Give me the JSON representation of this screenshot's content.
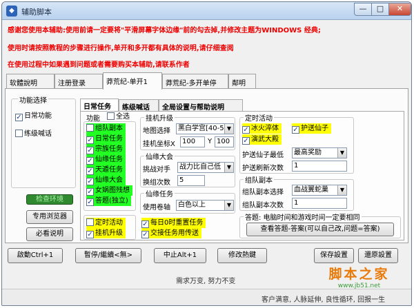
{
  "window": {
    "title": "辅助脚本",
    "icon": "app-icon",
    "controls": [
      "—",
      "□",
      "✕"
    ]
  },
  "notice": [
    "感谢您使用本辅助:使用前请一定要将\"平滑屏幕字体边缘\"前的勾去掉,并修改主题为WINDOWS 经典;",
    "使用时请按照教程的步骤进行操作,单开和多开都有具体的说明,请仔细查阅",
    "在使用过程中如果遇到问题或者需要购买本辅助,请联系作者"
  ],
  "main_tabs": [
    {
      "label": "软體說明",
      "active": false
    },
    {
      "label": "注册登录",
      "active": false
    },
    {
      "label": "莽荒纪-单开1",
      "active": true
    },
    {
      "label": "莽荒纪-多开单停",
      "active": false
    },
    {
      "label": "鄰明",
      "active": false
    }
  ],
  "function_select": {
    "title": "功能选择",
    "daily": {
      "label": "日常功能",
      "checked": true
    },
    "practice": {
      "label": "练级喊话",
      "checked": false
    },
    "env_check_button": "检查环境",
    "browser_button": "专用浏览器",
    "must_read_button": "必看说明"
  },
  "sub_tabs": [
    "日常任务",
    "练级喊话",
    "全局设置与帮助说明"
  ],
  "function_list": {
    "label": "功能",
    "select_all": {
      "label": "全选",
      "checked": false
    },
    "items": [
      {
        "label": "组队副本",
        "checked": false,
        "color": "#22ff22"
      },
      {
        "label": "日常任务",
        "checked": true,
        "color": "#22ff22"
      },
      {
        "label": "宗族任务",
        "checked": true,
        "color": "#22ff22"
      },
      {
        "label": "仙缘任务",
        "checked": true,
        "color": "#22ff22"
      },
      {
        "label": "天遁任务",
        "checked": true,
        "color": "#22ff22"
      },
      {
        "label": "仙缘大会",
        "checked": true,
        "color": "#22ff22"
      },
      {
        "label": "女娲图残想",
        "checked": true,
        "color": "#22ff22"
      },
      {
        "label": "答题(独立)",
        "checked": true,
        "color": "#22ff22"
      }
    ],
    "timed": {
      "label": "定时活动",
      "checked": false,
      "color": "#ffff00"
    },
    "hangup": {
      "label": "挂机升级",
      "checked": true,
      "color": "#ffff00"
    }
  },
  "hangup_panel": {
    "title": "挂机升级",
    "map_label": "地图选择",
    "map_value": "黑白学宫[40-50",
    "coord_label": "挂机坐标X",
    "x_value": "100",
    "y_label": "Y",
    "y_value": "100"
  },
  "immortal_panel": {
    "title": "仙缘大会",
    "opponent_label": "挑战对手",
    "opponent_value": "战力比自己低",
    "switch_label": "换组次数",
    "switch_value": "5"
  },
  "immortal_task": {
    "title": "仙缘任务",
    "scroll_label": "使用卷轴",
    "scroll_value": "白色以上"
  },
  "daily_reset": {
    "label": "每日0时重置任务",
    "checked": true,
    "color": "#ffff00"
  },
  "submit_task": {
    "label": "交接任务用传送",
    "checked": true,
    "color": "#ffff00"
  },
  "timed_activity": {
    "title": "定时活动",
    "ice_fire": {
      "label": "冰火淬体",
      "checked": true
    },
    "escort": {
      "label": "护送仙子",
      "checked": true
    },
    "martial": {
      "label": "演武大殿",
      "checked": true
    },
    "escort_min_label": "护送仙子最低",
    "escort_min_value": "最高奖励",
    "refresh_label": "护送刷新次数",
    "refresh_value": "1"
  },
  "team_dungeon": {
    "title": "组队副本",
    "select_label": "组队副本选择",
    "select_value": "血战翼蛇巢",
    "count_label": "组队副本次数",
    "count_value": "1"
  },
  "quiz": {
    "note": "答题: 电脑时间和游戏时间一定要相同",
    "button": "查看答题-答案(可以自己改,问题=答案)"
  },
  "bottom_buttons": {
    "start": "啟動Ctrl+1",
    "pause": "暫停/繼續<無>",
    "stop": "中止Alt+1",
    "hotkey": "修改熱鍵",
    "save": "保存設置",
    "restore": "還原設置"
  },
  "footer": {
    "slogan": "需求万变, 努力不变",
    "tagline": "客户满意, 人脉延伸, 良性循环, 回报一生"
  },
  "watermark": {
    "main": "脚本之家",
    "sub": "www.jb51.net"
  }
}
